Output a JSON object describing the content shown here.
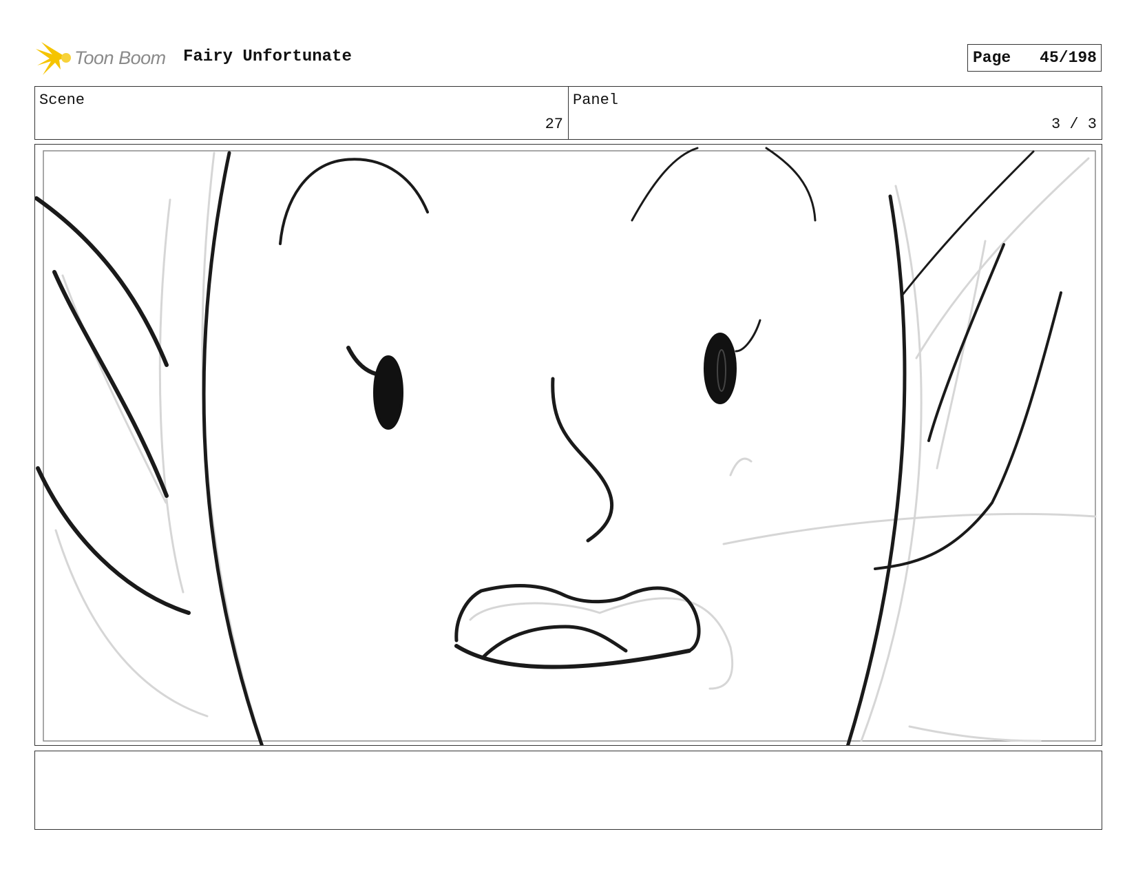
{
  "header": {
    "logo_text": "Toon Boom",
    "project_title": "Fairy Unfortunate",
    "page_label": "Page",
    "page_value": "45/198"
  },
  "info": {
    "scene_label": "Scene",
    "scene_value": "27",
    "panel_label": "Panel",
    "panel_value": "3 / 3"
  },
  "panel": {
    "drawing": "sketch of a surprised fairy face close-up"
  },
  "notes": {
    "text": ""
  },
  "colors": {
    "logo_accent": "#f5c400",
    "border": "#333333",
    "sketch_line": "#1a1a1a",
    "rough_line": "#d6d6d6"
  }
}
